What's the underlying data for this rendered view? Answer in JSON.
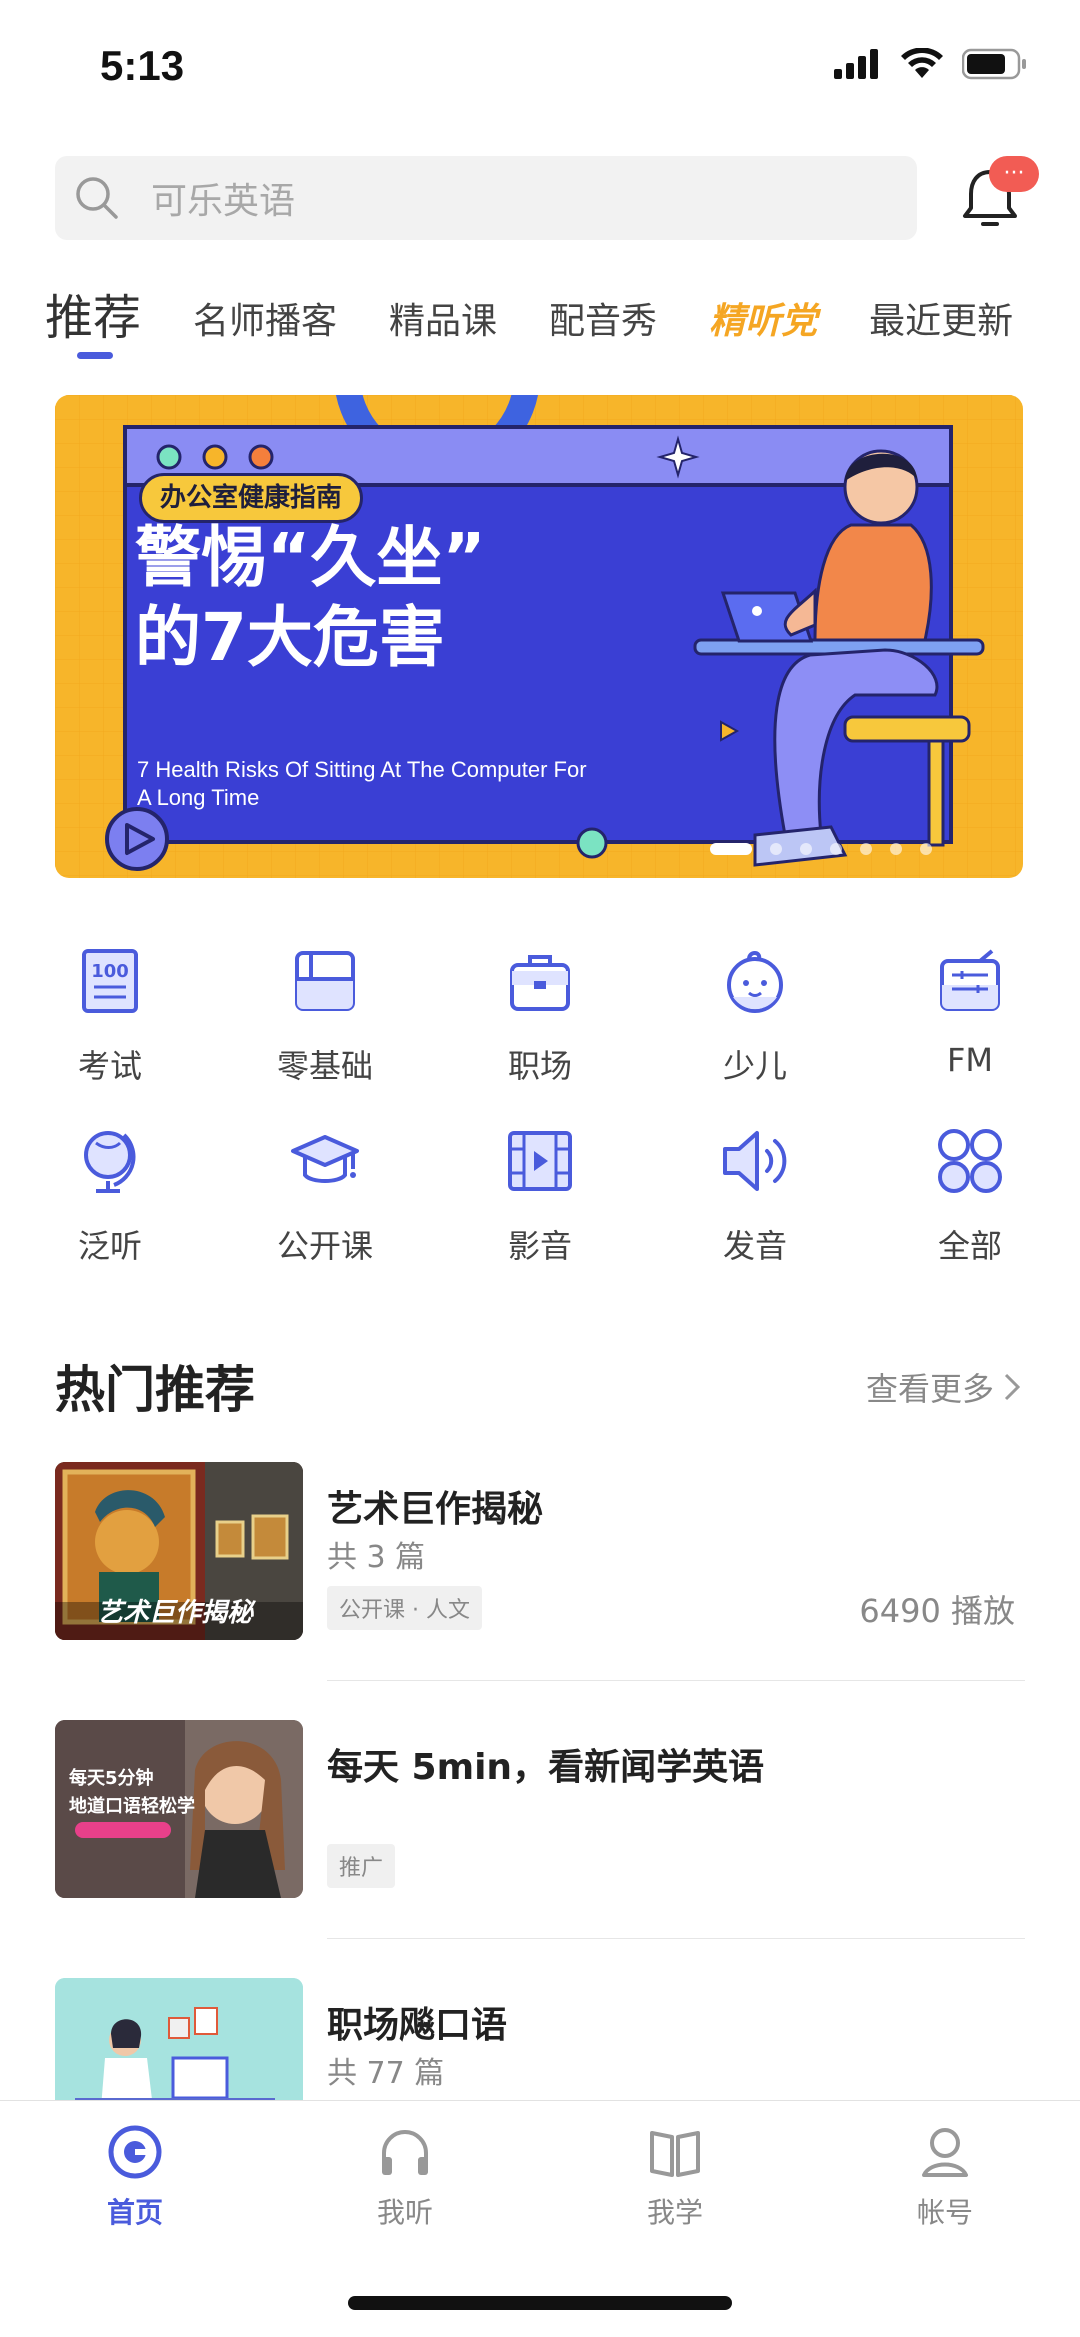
{
  "status_bar": {
    "time": "5:13"
  },
  "search": {
    "placeholder": "可乐英语",
    "badge": "···"
  },
  "tabs": [
    {
      "label": "推荐"
    },
    {
      "label": "名师播客"
    },
    {
      "label": "精品课"
    },
    {
      "label": "配音秀"
    },
    {
      "label": "精听党"
    },
    {
      "label": "最近更新"
    }
  ],
  "banner": {
    "tag": "办公室健康指南",
    "headline_1": "警惕“久坐”",
    "headline_2": "的7大危害",
    "subtitle_1": "7 Health Risks Of Sitting At The Computer For",
    "subtitle_2": "A Long Time",
    "page_count": 7,
    "active_page": 1
  },
  "categories": [
    {
      "label": "考试",
      "icon": "exam-icon"
    },
    {
      "label": "零基础",
      "icon": "folder-icon"
    },
    {
      "label": "职场",
      "icon": "briefcase-icon"
    },
    {
      "label": "少儿",
      "icon": "baby-face-icon"
    },
    {
      "label": "FM",
      "icon": "radio-icon"
    },
    {
      "label": "泛听",
      "icon": "globe-icon"
    },
    {
      "label": "公开课",
      "icon": "graduation-cap-icon"
    },
    {
      "label": "影音",
      "icon": "film-icon"
    },
    {
      "label": "发音",
      "icon": "speaker-icon"
    },
    {
      "label": "全部",
      "icon": "grid-icon"
    }
  ],
  "section": {
    "title": "热门推荐",
    "see_more": "查看更多"
  },
  "list": [
    {
      "title": "艺术巨作揭秘",
      "count": "共 3 篇",
      "tag": "公开课 · 人文",
      "plays": "6490 播放",
      "thumb_text": "艺术巨作揭秘"
    },
    {
      "title": "每天 5min，看新闻学英语",
      "count": "",
      "tag": "推广",
      "plays": "",
      "thumb_text_1": "每天5分钟",
      "thumb_text_2": "地道口语轻松学"
    },
    {
      "title": "职场飚口语",
      "count": "共 77 篇",
      "tag": "",
      "plays": ""
    }
  ],
  "bottom_nav": [
    {
      "label": "首页",
      "icon": "home-icon",
      "active": true
    },
    {
      "label": "我听",
      "icon": "headphones-icon",
      "active": false
    },
    {
      "label": "我学",
      "icon": "book-icon",
      "active": false
    },
    {
      "label": "帐号",
      "icon": "account-icon",
      "active": false
    }
  ],
  "colors": {
    "accent": "#4a5bdc",
    "banner_bg": "#f7b52a",
    "banner_panel": "#3a3fd4",
    "badge": "#f25c54"
  }
}
